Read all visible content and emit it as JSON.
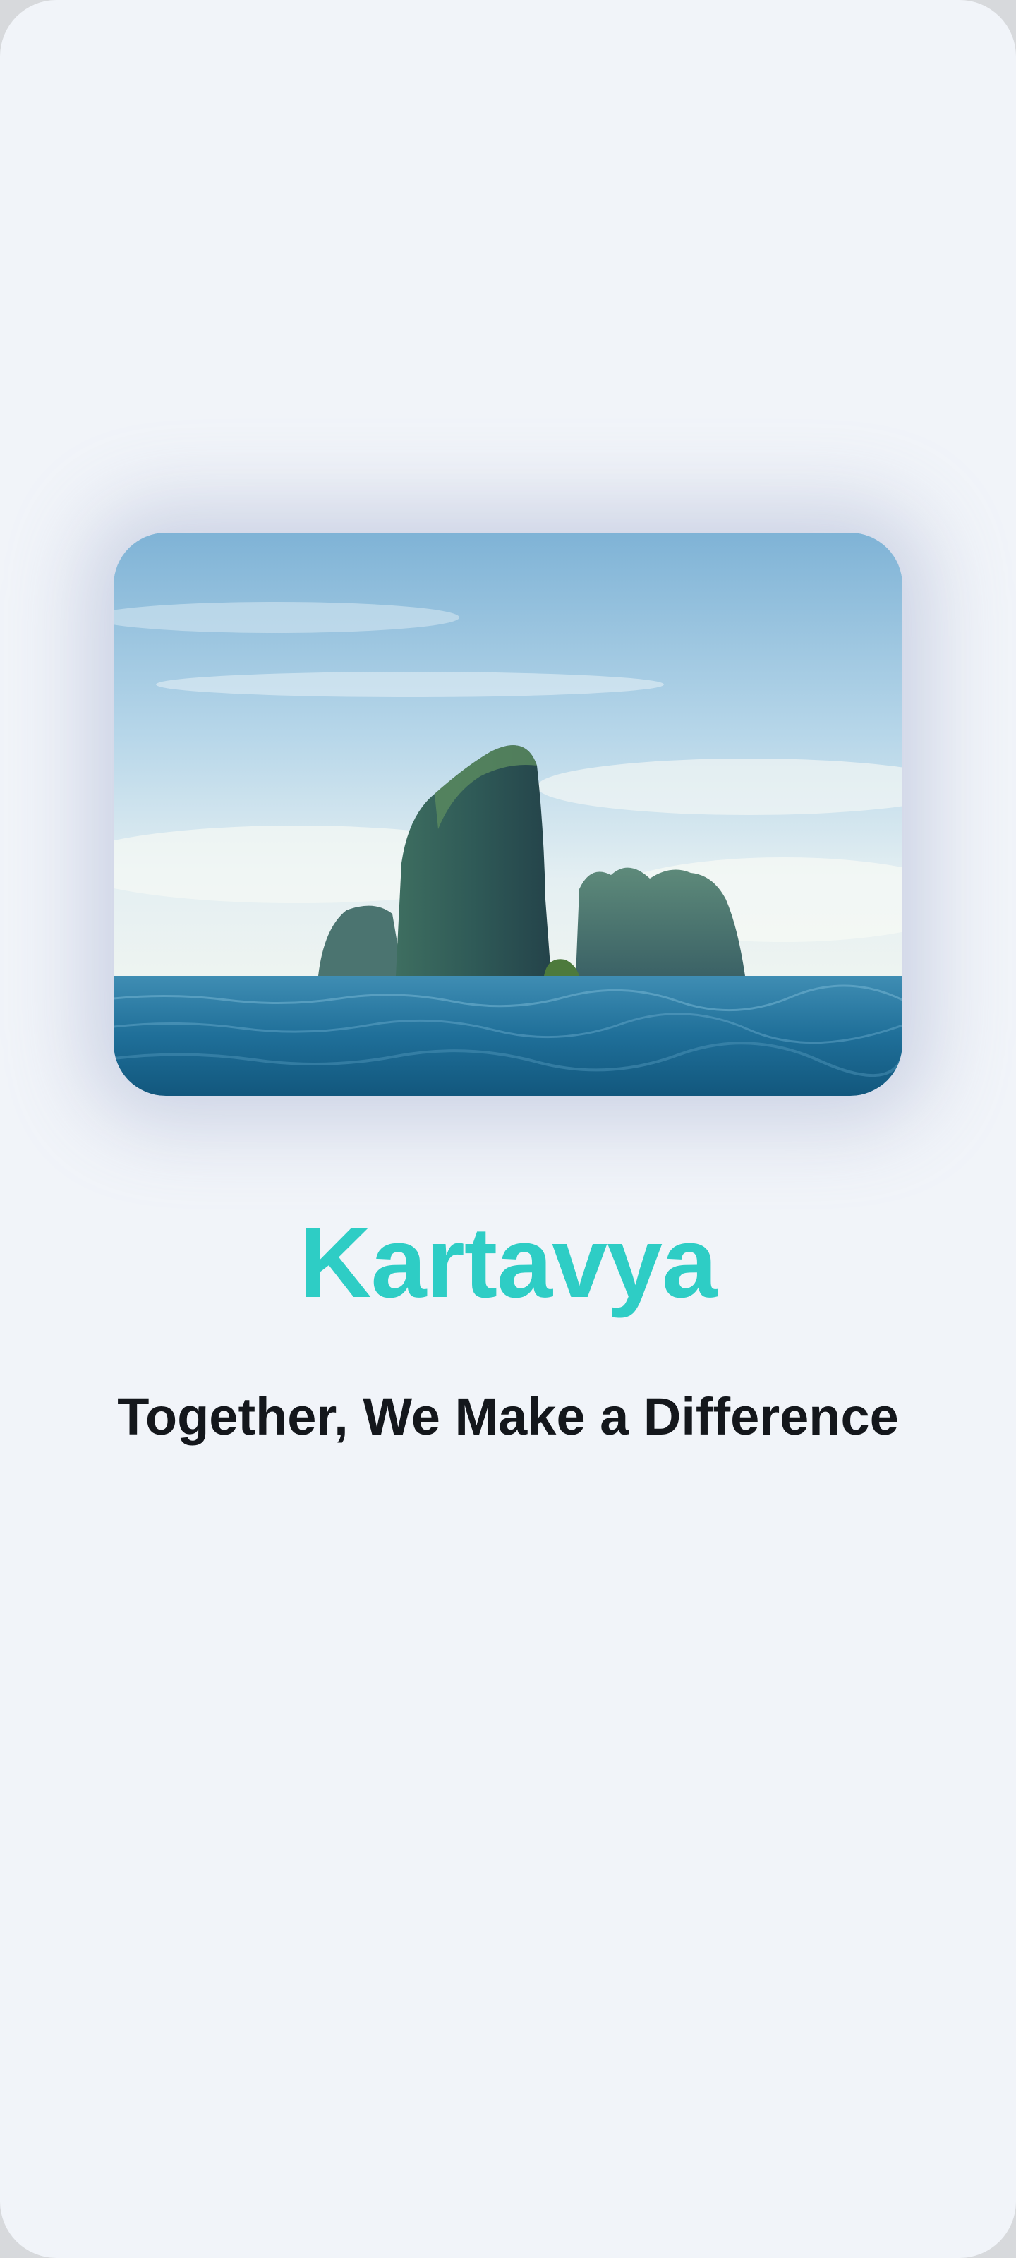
{
  "app": {
    "name": "Kartavya",
    "tagline": "Together, We Make a Difference"
  },
  "hero": {
    "image": "sea-rock-island-photo"
  },
  "colors": {
    "background": "#f1f4f9",
    "brand": "#2ecdc5",
    "tagline": "#14171c"
  }
}
